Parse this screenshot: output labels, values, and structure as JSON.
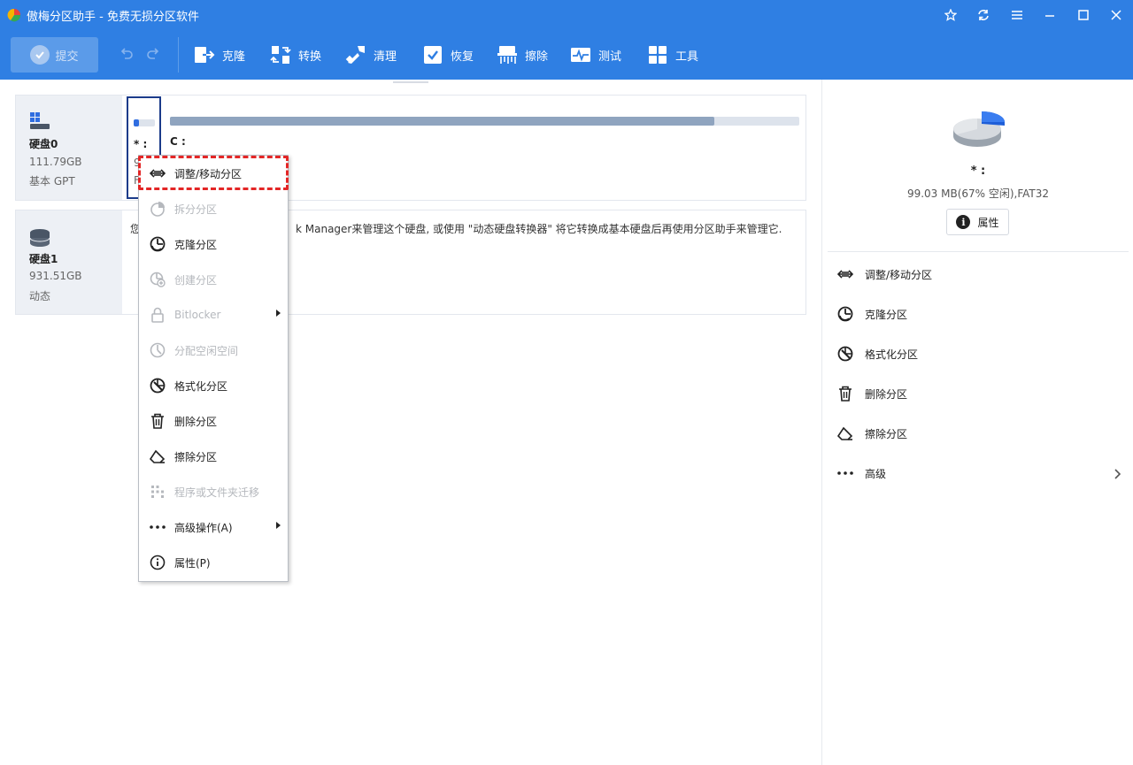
{
  "window": {
    "title": "傲梅分区助手 - 免费无损分区软件",
    "controls": [
      "star-icon",
      "refresh-icon",
      "menu-icon",
      "minimize-icon",
      "maximize-icon",
      "close-icon"
    ]
  },
  "toolbar": {
    "submit_label": "提交",
    "items": [
      {
        "label": "克隆",
        "icon": "clone-icon"
      },
      {
        "label": "转换",
        "icon": "convert-icon"
      },
      {
        "label": "清理",
        "icon": "clean-icon"
      },
      {
        "label": "恢复",
        "icon": "recover-icon"
      },
      {
        "label": "擦除",
        "icon": "wipe-icon"
      },
      {
        "label": "测试",
        "icon": "test-icon"
      },
      {
        "label": "工具",
        "icon": "tools-icon"
      }
    ]
  },
  "disks": [
    {
      "name": "硬盘0",
      "size": "111.79GB",
      "type": "基本 GPT",
      "partitions": [
        {
          "label": "* :",
          "size_partial": "9",
          "fs_partial": "F",
          "used_fraction": 0.25
        },
        {
          "label": "C :",
          "used_fraction": 0.865
        }
      ]
    },
    {
      "name": "硬盘1",
      "size": "931.51GB",
      "type": "动态",
      "message_prefix": "您",
      "message": "k Manager来管理这个硬盘, 或使用 \"动态硬盘转换器\" 将它转换成基本硬盘后再使用分区助手来管理它."
    }
  ],
  "context_menu": {
    "items": [
      {
        "label": "调整/移动分区",
        "icon": "resize-icon",
        "enabled": true
      },
      {
        "label": "拆分分区",
        "icon": "split-icon",
        "enabled": false
      },
      {
        "label": "克隆分区",
        "icon": "clone-partition-icon",
        "enabled": true
      },
      {
        "label": "创建分区",
        "icon": "create-partition-icon",
        "enabled": false
      },
      {
        "label": "Bitlocker",
        "icon": "lock-icon",
        "enabled": false,
        "submenu": true
      },
      {
        "label": "分配空闲空间",
        "icon": "allocate-icon",
        "enabled": false
      },
      {
        "label": "格式化分区",
        "icon": "format-icon",
        "enabled": true
      },
      {
        "label": "删除分区",
        "icon": "trash-icon",
        "enabled": true
      },
      {
        "label": "擦除分区",
        "icon": "eraser-icon",
        "enabled": true
      },
      {
        "label": "程序或文件夹迁移",
        "icon": "migrate-icon",
        "enabled": false
      },
      {
        "label": "高级操作(A)",
        "icon": "more-icon",
        "enabled": true,
        "submenu": true
      },
      {
        "label": "属性(P)",
        "icon": "info-icon",
        "enabled": true
      }
    ]
  },
  "right_pane": {
    "partition_name": "* :",
    "partition_detail": "99.03 MB(67% 空闲),FAT32",
    "properties_label": "属性",
    "actions": [
      {
        "label": "调整/移动分区",
        "icon": "resize-icon"
      },
      {
        "label": "克隆分区",
        "icon": "clone-partition-icon"
      },
      {
        "label": "格式化分区",
        "icon": "format-icon"
      },
      {
        "label": "删除分区",
        "icon": "trash-icon"
      },
      {
        "label": "擦除分区",
        "icon": "eraser-icon"
      },
      {
        "label": "高级",
        "icon": "more-icon"
      }
    ]
  },
  "colors": {
    "header_blue": "#2f7fe3",
    "highlight_red": "#e32626",
    "selected_border": "#1b3b8a"
  }
}
